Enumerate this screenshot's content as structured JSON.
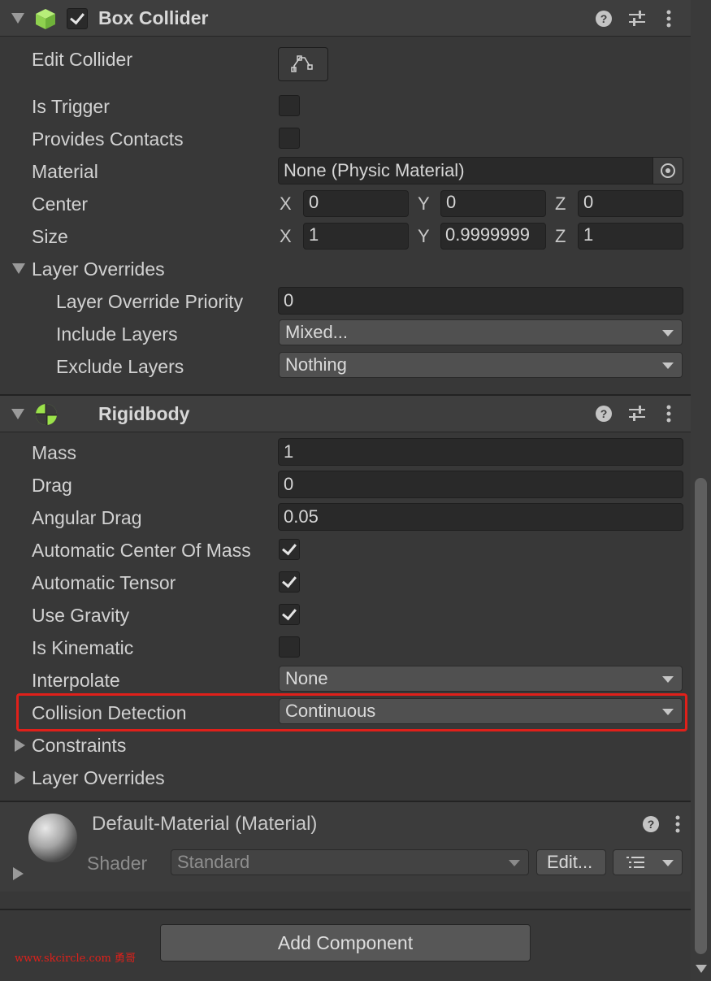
{
  "box_collider": {
    "title": "Box Collider",
    "enabled": true,
    "edit_collider_label": "Edit Collider",
    "is_trigger_label": "Is Trigger",
    "is_trigger": false,
    "provides_contacts_label": "Provides Contacts",
    "provides_contacts": false,
    "material_label": "Material",
    "material_value": "None (Physic Material)",
    "center_label": "Center",
    "center": {
      "x_label": "X",
      "x": "0",
      "y_label": "Y",
      "y": "0",
      "z_label": "Z",
      "z": "0"
    },
    "size_label": "Size",
    "size": {
      "x_label": "X",
      "x": "1",
      "y_label": "Y",
      "y": "0.9999999",
      "z_label": "Z",
      "z": "1"
    },
    "layer_overrides_label": "Layer Overrides",
    "layer_override_priority_label": "Layer Override Priority",
    "layer_override_priority": "0",
    "include_layers_label": "Include Layers",
    "include_layers": "Mixed...",
    "exclude_layers_label": "Exclude Layers",
    "exclude_layers": "Nothing"
  },
  "rigidbody": {
    "title": "Rigidbody",
    "mass_label": "Mass",
    "mass": "1",
    "drag_label": "Drag",
    "drag": "0",
    "angular_drag_label": "Angular Drag",
    "angular_drag": "0.05",
    "auto_center_label": "Automatic Center Of Mass",
    "auto_center": true,
    "auto_tensor_label": "Automatic Tensor",
    "auto_tensor": true,
    "use_gravity_label": "Use Gravity",
    "use_gravity": true,
    "is_kinematic_label": "Is Kinematic",
    "is_kinematic": false,
    "interpolate_label": "Interpolate",
    "interpolate": "None",
    "collision_detection_label": "Collision Detection",
    "collision_detection": "Continuous",
    "constraints_label": "Constraints",
    "layer_overrides_label": "Layer Overrides"
  },
  "material": {
    "title": "Default-Material (Material)",
    "shader_label": "Shader",
    "shader_value": "Standard",
    "edit_label": "Edit..."
  },
  "footer": {
    "add_component_label": "Add Component",
    "watermark": "www.skcircle.com 勇哥"
  },
  "colors": {
    "highlight": "#e0201a",
    "collider_icon": "#8fd14f",
    "rigidbody_icon": "#9be24a"
  }
}
